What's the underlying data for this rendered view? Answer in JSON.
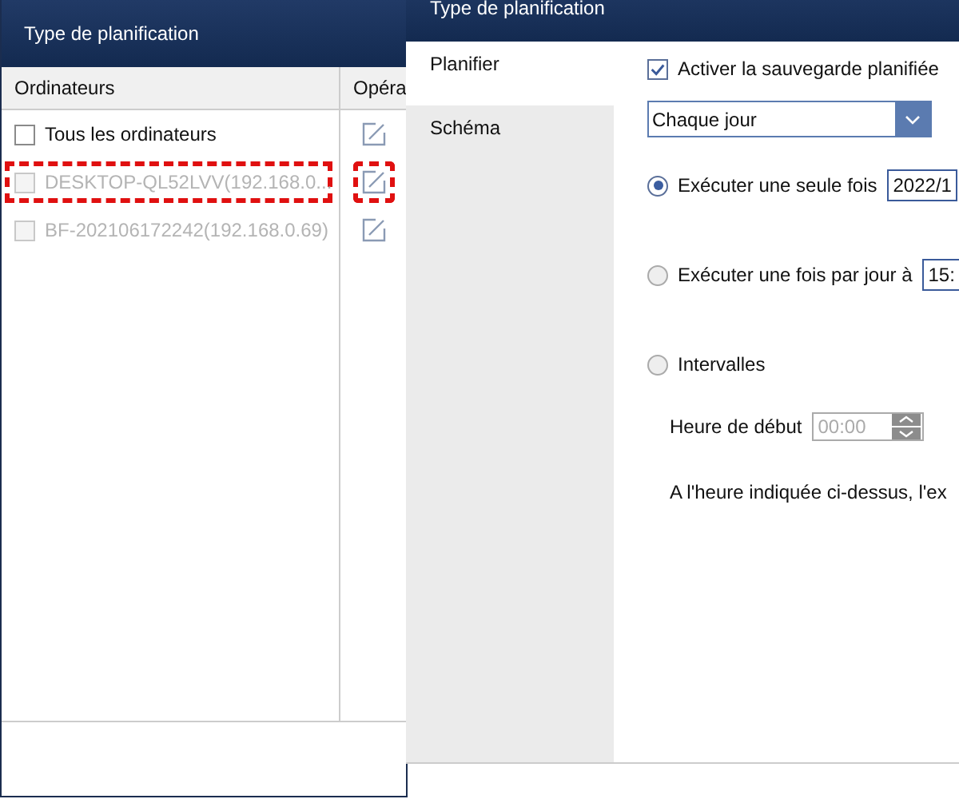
{
  "back_window": {
    "title": "Type de planification",
    "table": {
      "columns": [
        "Ordinateurs",
        "Opéra"
      ],
      "rows": [
        {
          "name": "Tous les ordinateurs",
          "checked": false,
          "disabled": false,
          "highlighted": false
        },
        {
          "name": "DESKTOP-QL52LVV(192.168.0...",
          "checked": false,
          "disabled": true,
          "highlighted": true
        },
        {
          "name": "BF-202106172242(192.168.0.69)",
          "checked": false,
          "disabled": true,
          "highlighted": false
        }
      ]
    }
  },
  "front_window": {
    "title": "Type de planification",
    "tabs": [
      {
        "label": "Planifier",
        "selected": true
      },
      {
        "label": "Schéma",
        "selected": false
      }
    ],
    "enable": {
      "label": "Activer la sauvegarde planifiée",
      "checked": true
    },
    "frequency": {
      "value": "Chaque jour"
    },
    "options": [
      {
        "label": "Exécuter une seule fois",
        "selected": true,
        "value": "2022/1"
      },
      {
        "label": "Exécuter une fois par jour à",
        "selected": false,
        "value": "15:"
      },
      {
        "label": "Intervalles",
        "selected": false
      }
    ],
    "start": {
      "label": "Heure de début",
      "value": "00:00",
      "disabled": true
    },
    "note": "A l'heure indiquée ci-dessus, l'ex"
  }
}
